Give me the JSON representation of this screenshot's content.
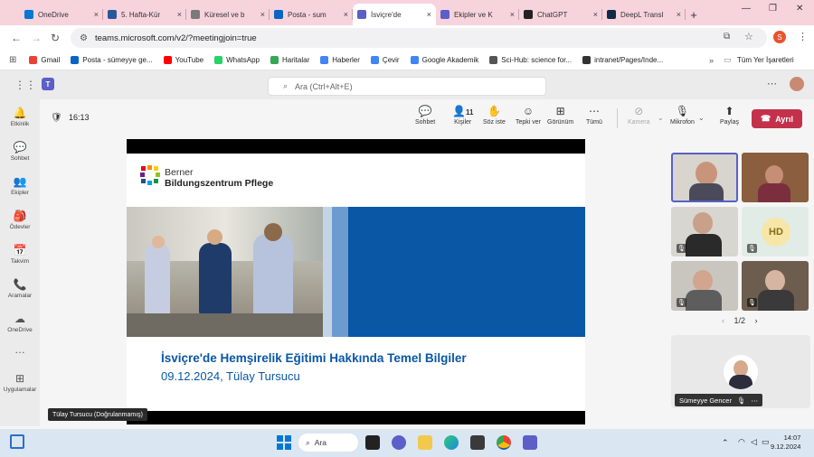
{
  "browser": {
    "tabs": [
      {
        "label": "OneDrive",
        "color": "#0078d4"
      },
      {
        "label": "5. Hafta-Kür",
        "color": "#2b579a"
      },
      {
        "label": "Küresel ve b",
        "color": "#7a7a7a"
      },
      {
        "label": "Posta - sum",
        "color": "#0a64c4"
      },
      {
        "label": "İsviçre'de",
        "color": "#5b5fc7",
        "active": true
      },
      {
        "label": "Ekipler ve K",
        "color": "#5b5fc7"
      },
      {
        "label": "ChatGPT",
        "color": "#222222"
      },
      {
        "label": "DeepL Transl",
        "color": "#0f2b46"
      }
    ],
    "new_tab": "+",
    "url": "teams.microsoft.com/v2/?meetingjoin=true",
    "profile_initial": "S",
    "bookmarks": [
      {
        "label": "Gmail",
        "color": "#ea4335"
      },
      {
        "label": "Posta - sümeyye ge...",
        "color": "#0a64c4"
      },
      {
        "label": "YouTube",
        "color": "#ff0000"
      },
      {
        "label": "WhatsApp",
        "color": "#25d366"
      },
      {
        "label": "Haritalar",
        "color": "#34a853"
      },
      {
        "label": "Haberler",
        "color": "#4285f4"
      },
      {
        "label": "Çevir",
        "color": "#4285f4"
      },
      {
        "label": "Google Akademik",
        "color": "#4285f4"
      },
      {
        "label": "Sci-Hub: science for...",
        "color": "#555555"
      },
      {
        "label": "intranet/Pages/Inde...",
        "color": "#333333"
      }
    ],
    "all_bookmarks": "Tüm Yer İşaretleri"
  },
  "teams": {
    "search_placeholder": "Ara (Ctrl+Alt+E)",
    "rail": [
      {
        "label": "Etkinlik",
        "icon": "bell-icon",
        "glyph": "🔔"
      },
      {
        "label": "Sohbet",
        "icon": "chat-icon",
        "glyph": "💬"
      },
      {
        "label": "Ekipler",
        "icon": "teams-icon",
        "glyph": "👥"
      },
      {
        "label": "Ödevler",
        "icon": "bag-icon",
        "glyph": "🎒"
      },
      {
        "label": "Takvim",
        "icon": "calendar-icon",
        "glyph": "📅"
      },
      {
        "label": "Aramalar",
        "icon": "phone-icon",
        "glyph": "📞"
      },
      {
        "label": "OneDrive",
        "icon": "cloud-icon",
        "glyph": "☁"
      },
      {
        "label": "",
        "icon": "more-icon",
        "glyph": "…"
      },
      {
        "label": "Uygulamalar",
        "icon": "apps-add-icon",
        "glyph": "⊞"
      }
    ],
    "meeting_timer": "16:13",
    "toolbar": {
      "chat": "Sohbet",
      "people": "Kişiler",
      "people_count": "11",
      "raise_hand": "Söz iste",
      "react": "Tepki ver",
      "view": "Görünüm",
      "more": "Tümü",
      "camera": "Kamera",
      "mic": "Mikrofon",
      "share": "Paylaş",
      "leave": "Ayrıl"
    },
    "slide": {
      "brand_line1": "Berner",
      "brand_line2": "Bildungszentrum Pflege",
      "title": "İsviçre'de Hemşirelik Eğitimi Hakkında Temel Bilgiler",
      "subtitle": "09.12.2024, Tülay Tursucu"
    },
    "presenter_label": "Tülay Tursucu (Doğrulanmamış)",
    "gallery_initials": "HD",
    "pager": "1/2",
    "self_name": "Sümeyye Gencer"
  },
  "taskbar": {
    "search": "Ara",
    "time": "14:07",
    "date": "9.12.2024"
  }
}
